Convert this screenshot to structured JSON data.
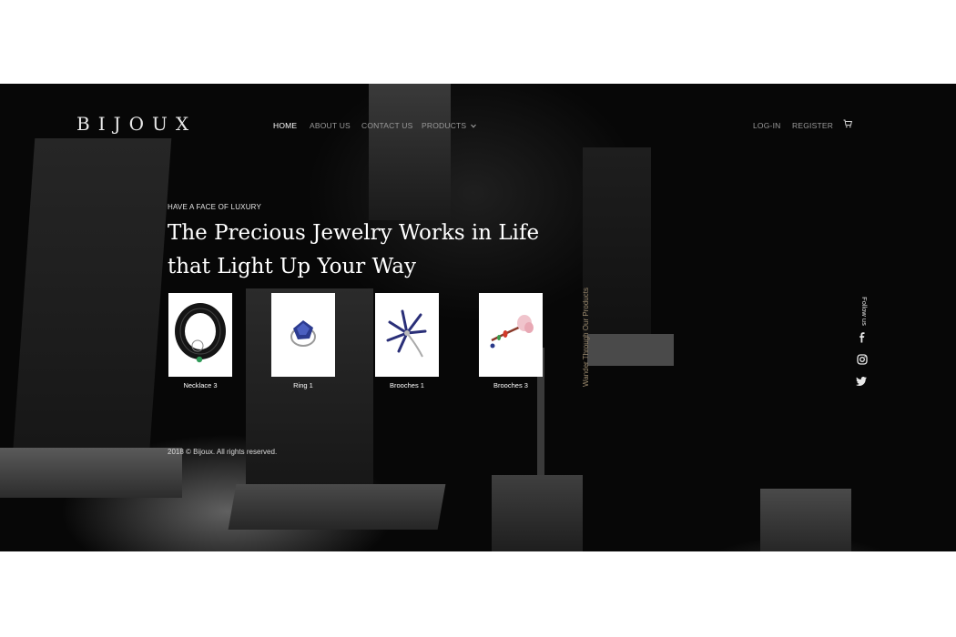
{
  "brand": {
    "logo_text": "BIJOUX"
  },
  "nav": {
    "items": [
      "HOME",
      "ABOUT US",
      "CONTACT US",
      "PRODUCTS"
    ],
    "products_dropdown_icon": "chevron-down-icon",
    "login": "LOG-IN",
    "register": "REGISTER",
    "cart_icon": "cart-icon"
  },
  "hero": {
    "eyebrow": "HAVE A FACE OF LUXURY",
    "title_line1": "The Precious Jewelry Works in Life",
    "title_line2": "that Light Up Your Way"
  },
  "products": [
    {
      "name": "Necklace 3",
      "icon": "necklace-image"
    },
    {
      "name": "Ring 1",
      "icon": "ring-image"
    },
    {
      "name": "Brooches 1",
      "icon": "brooch-image"
    },
    {
      "name": "Brooches 3",
      "icon": "flower-brooch-image"
    }
  ],
  "side": {
    "wander_text": "Wander Through Our Products",
    "follow_text": "Follow us",
    "social_icons": [
      "facebook-icon",
      "instagram-icon",
      "twitter-icon"
    ]
  },
  "footer": {
    "copyright": "2018 © Bijoux. All rights reserved."
  },
  "colors": {
    "background": "#070707",
    "text": "#ffffff",
    "nav_muted": "#9a9a9a",
    "accent_gold": "#9b8a6e"
  }
}
